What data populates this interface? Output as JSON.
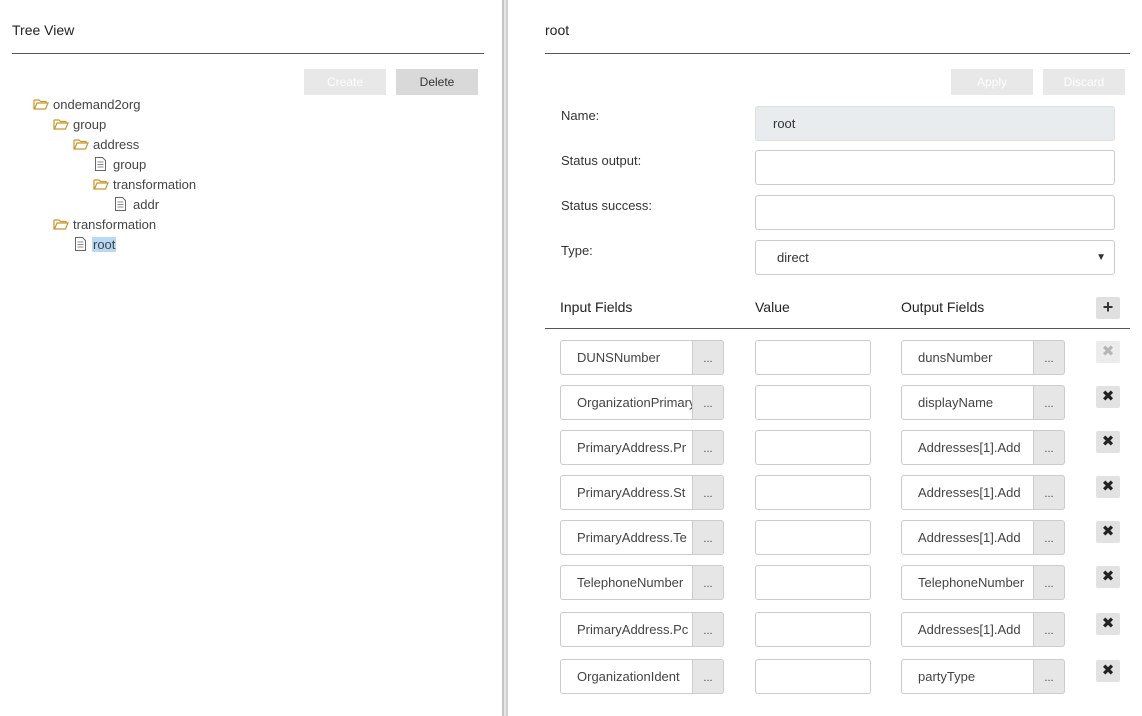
{
  "tree_panel": {
    "title": "Tree View",
    "create_label": "Create",
    "delete_label": "Delete",
    "nodes": [
      {
        "label": "ondemand2org",
        "icon": "folder-open-icon"
      },
      {
        "label": "group",
        "icon": "folder-open-icon"
      },
      {
        "label": "address",
        "icon": "folder-open-icon"
      },
      {
        "label": "group",
        "icon": "document-icon"
      },
      {
        "label": "transformation",
        "icon": "folder-open-icon"
      },
      {
        "label": "addr",
        "icon": "document-icon"
      },
      {
        "label": "transformation",
        "icon": "folder-open-icon"
      },
      {
        "label": "root",
        "icon": "document-icon",
        "selected": true
      }
    ]
  },
  "detail_panel": {
    "title": "root",
    "apply_label": "Apply",
    "discard_label": "Discard",
    "form": {
      "name_label": "Name:",
      "name_value": "root",
      "status_output_label": "Status output:",
      "status_output_value": "",
      "status_success_label": "Status success:",
      "status_success_value": "",
      "type_label": "Type:",
      "type_value": "direct"
    },
    "mapping": {
      "headers": {
        "input": "Input Fields",
        "value": "Value",
        "output": "Output Fields"
      },
      "more_label": "...",
      "rows": [
        {
          "input": "DUNSNumber",
          "value": "",
          "output": "dunsNumber",
          "delete_enabled": false
        },
        {
          "input": "OrganizationPrimary",
          "value": "",
          "output": "displayName",
          "delete_enabled": true
        },
        {
          "input": "PrimaryAddress.Pr",
          "value": "",
          "output": "Addresses[1].Add",
          "delete_enabled": true
        },
        {
          "input": "PrimaryAddress.St",
          "value": "",
          "output": "Addresses[1].Add",
          "delete_enabled": true
        },
        {
          "input": "PrimaryAddress.Te",
          "value": "",
          "output": "Addresses[1].Add",
          "delete_enabled": true
        },
        {
          "input": "TelephoneNumber",
          "value": "",
          "output": "TelephoneNumber",
          "delete_enabled": true
        },
        {
          "input": "PrimaryAddress.Pc",
          "value": "",
          "output": "Addresses[1].Add",
          "delete_enabled": true
        },
        {
          "input": "OrganizationIdent",
          "value": "",
          "output": "partyType",
          "delete_enabled": true
        }
      ]
    }
  },
  "colors": {
    "selection": "#b8d8f4",
    "folder": "#c9962a",
    "button": "#d9d9d9",
    "button_disabled": "#e8e8e8"
  }
}
